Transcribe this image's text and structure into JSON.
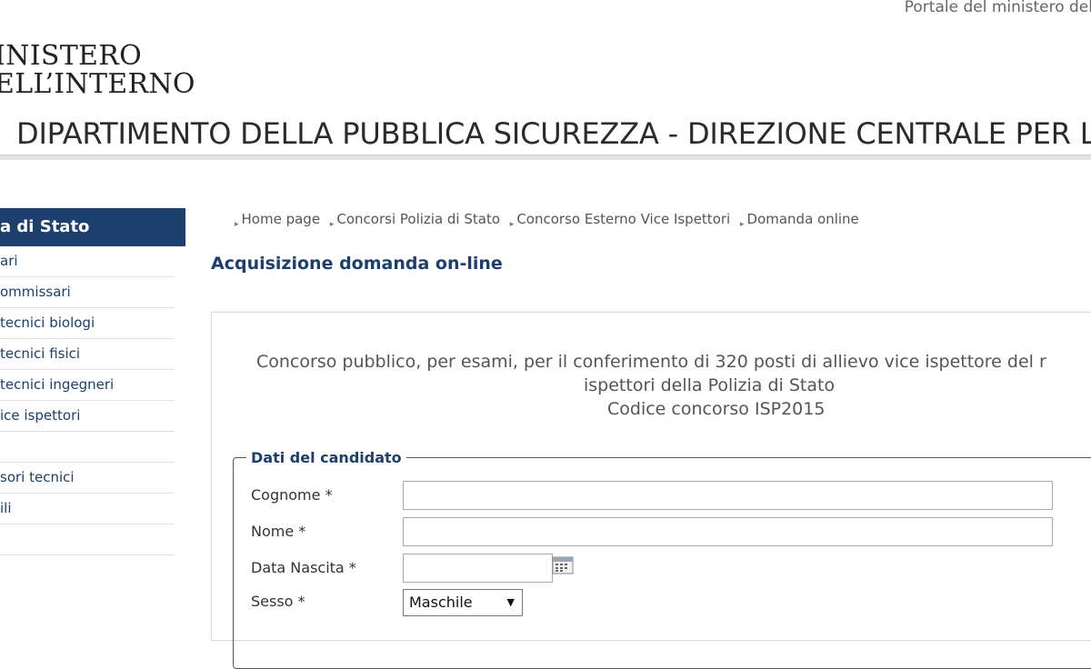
{
  "header": {
    "portal_link": "Portale del ministero del",
    "logo_line1": "INISTERO",
    "logo_line2": "ELL’INTERNO",
    "department": "DIPARTIMENTO DELLA PUBBLICA SICUREZZA - DIREZIONE CENTRALE PER LE R"
  },
  "sidebar": {
    "header": "a di Stato",
    "items": [
      {
        "label": "ari"
      },
      {
        "label": "ommissari"
      },
      {
        "label": "tecnici biologi"
      },
      {
        "label": "tecnici fisici"
      },
      {
        "label": "tecnici ingegneri"
      },
      {
        "label": "ice ispettori"
      },
      {
        "label": ""
      },
      {
        "label": "sori tecnici"
      },
      {
        "label": "ili"
      },
      {
        "label": ""
      }
    ]
  },
  "breadcrumb": [
    "Home page",
    "Concorsi Polizia di Stato",
    "Concorso Esterno Vice Ispettori",
    "Domanda online"
  ],
  "page_title": "Acquisizione domanda on-line",
  "concorso": {
    "line1": "Concorso pubblico, per esami, per il conferimento di 320 posti di allievo vice ispettore del r",
    "line2": "ispettori della Polizia di Stato",
    "line3": "Codice concorso ISP2015"
  },
  "form": {
    "legend": "Dati del candidato",
    "cognome_label": "Cognome *",
    "cognome_value": "",
    "nome_label": "Nome *",
    "nome_value": "",
    "data_nascita_label": "Data Nascita *",
    "data_nascita_value": "",
    "sesso_label": "Sesso *",
    "sesso_value": "Maschile"
  },
  "colors": {
    "accent": "#1c3f6e",
    "sidebar_header_bg": "#1c3f6e"
  },
  "icons": {
    "calendar": "calendar-icon",
    "select_arrow": "chevron-down-icon",
    "breadcrumb_separator": "breadcrumb-arrow-icon"
  }
}
